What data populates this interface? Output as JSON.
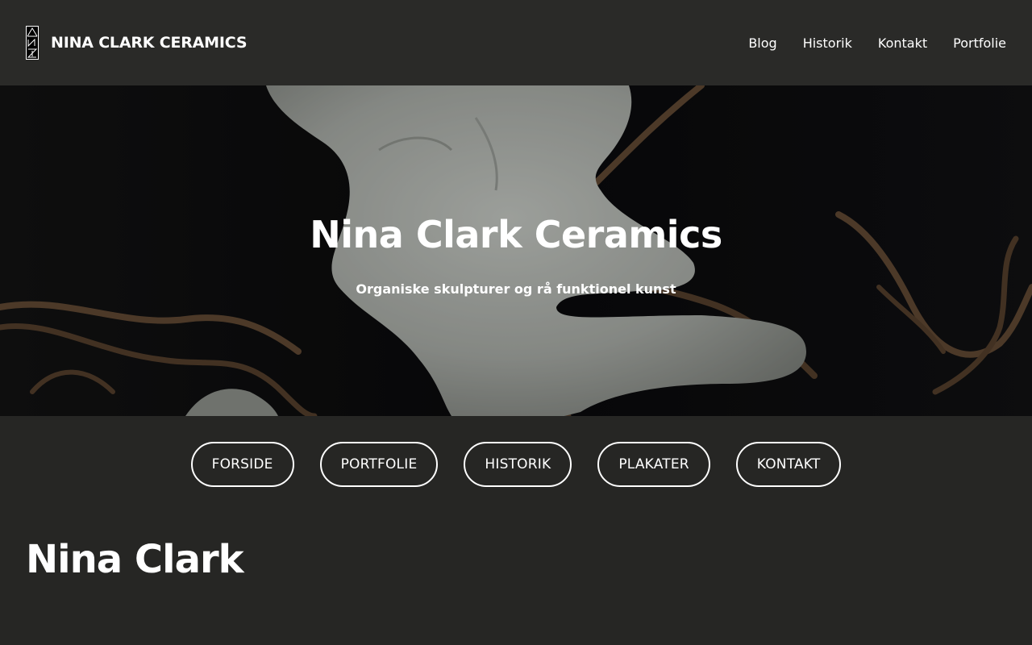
{
  "header": {
    "brand_name": "NINA CLARK CERAMICS",
    "logo_icon": "nc-monogram-icon",
    "nav": [
      {
        "label": "Blog"
      },
      {
        "label": "Historik"
      },
      {
        "label": "Kontakt"
      },
      {
        "label": "Portfolie"
      }
    ]
  },
  "hero": {
    "title": "Nina Clark Ceramics",
    "subtitle": "Organiske skulpturer og rå funktionel kunst"
  },
  "pill_nav": [
    {
      "label": "FORSIDE"
    },
    {
      "label": "PORTFOLIE"
    },
    {
      "label": "HISTORIK"
    },
    {
      "label": "PLAKATER"
    },
    {
      "label": "KONTAKT"
    }
  ],
  "main": {
    "heading": "Nina Clark"
  },
  "colors": {
    "background": "#262624",
    "header_bg": "#2a2a28",
    "text": "#ffffff"
  }
}
